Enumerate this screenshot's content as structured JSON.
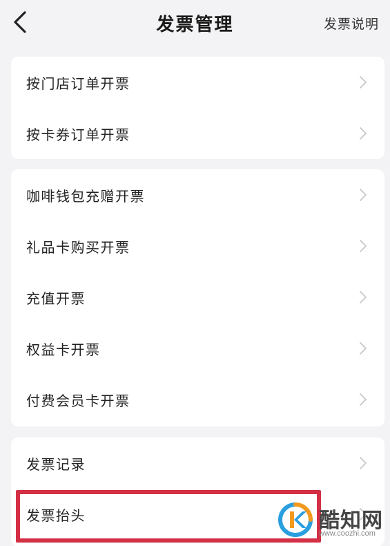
{
  "header": {
    "title": "发票管理",
    "help_label": "发票说明"
  },
  "groups": [
    {
      "items": [
        {
          "label": "按门店订单开票"
        },
        {
          "label": "按卡券订单开票"
        }
      ]
    },
    {
      "items": [
        {
          "label": "咖啡钱包充赠开票"
        },
        {
          "label": "礼品卡购买开票"
        },
        {
          "label": "充值开票"
        },
        {
          "label": "权益卡开票"
        },
        {
          "label": "付费会员卡开票"
        }
      ]
    },
    {
      "items": [
        {
          "label": "发票记录"
        },
        {
          "label": "发票抬头"
        }
      ]
    }
  ],
  "watermark": {
    "name": "酷知网",
    "url": "www.coozhi.com"
  },
  "colors": {
    "background": "#f3f3f5",
    "highlight": "#d32f45",
    "chevron": "#c8c8c8"
  },
  "icons": {
    "back": "chevron-left-icon",
    "row_arrow": "chevron-right-icon"
  }
}
